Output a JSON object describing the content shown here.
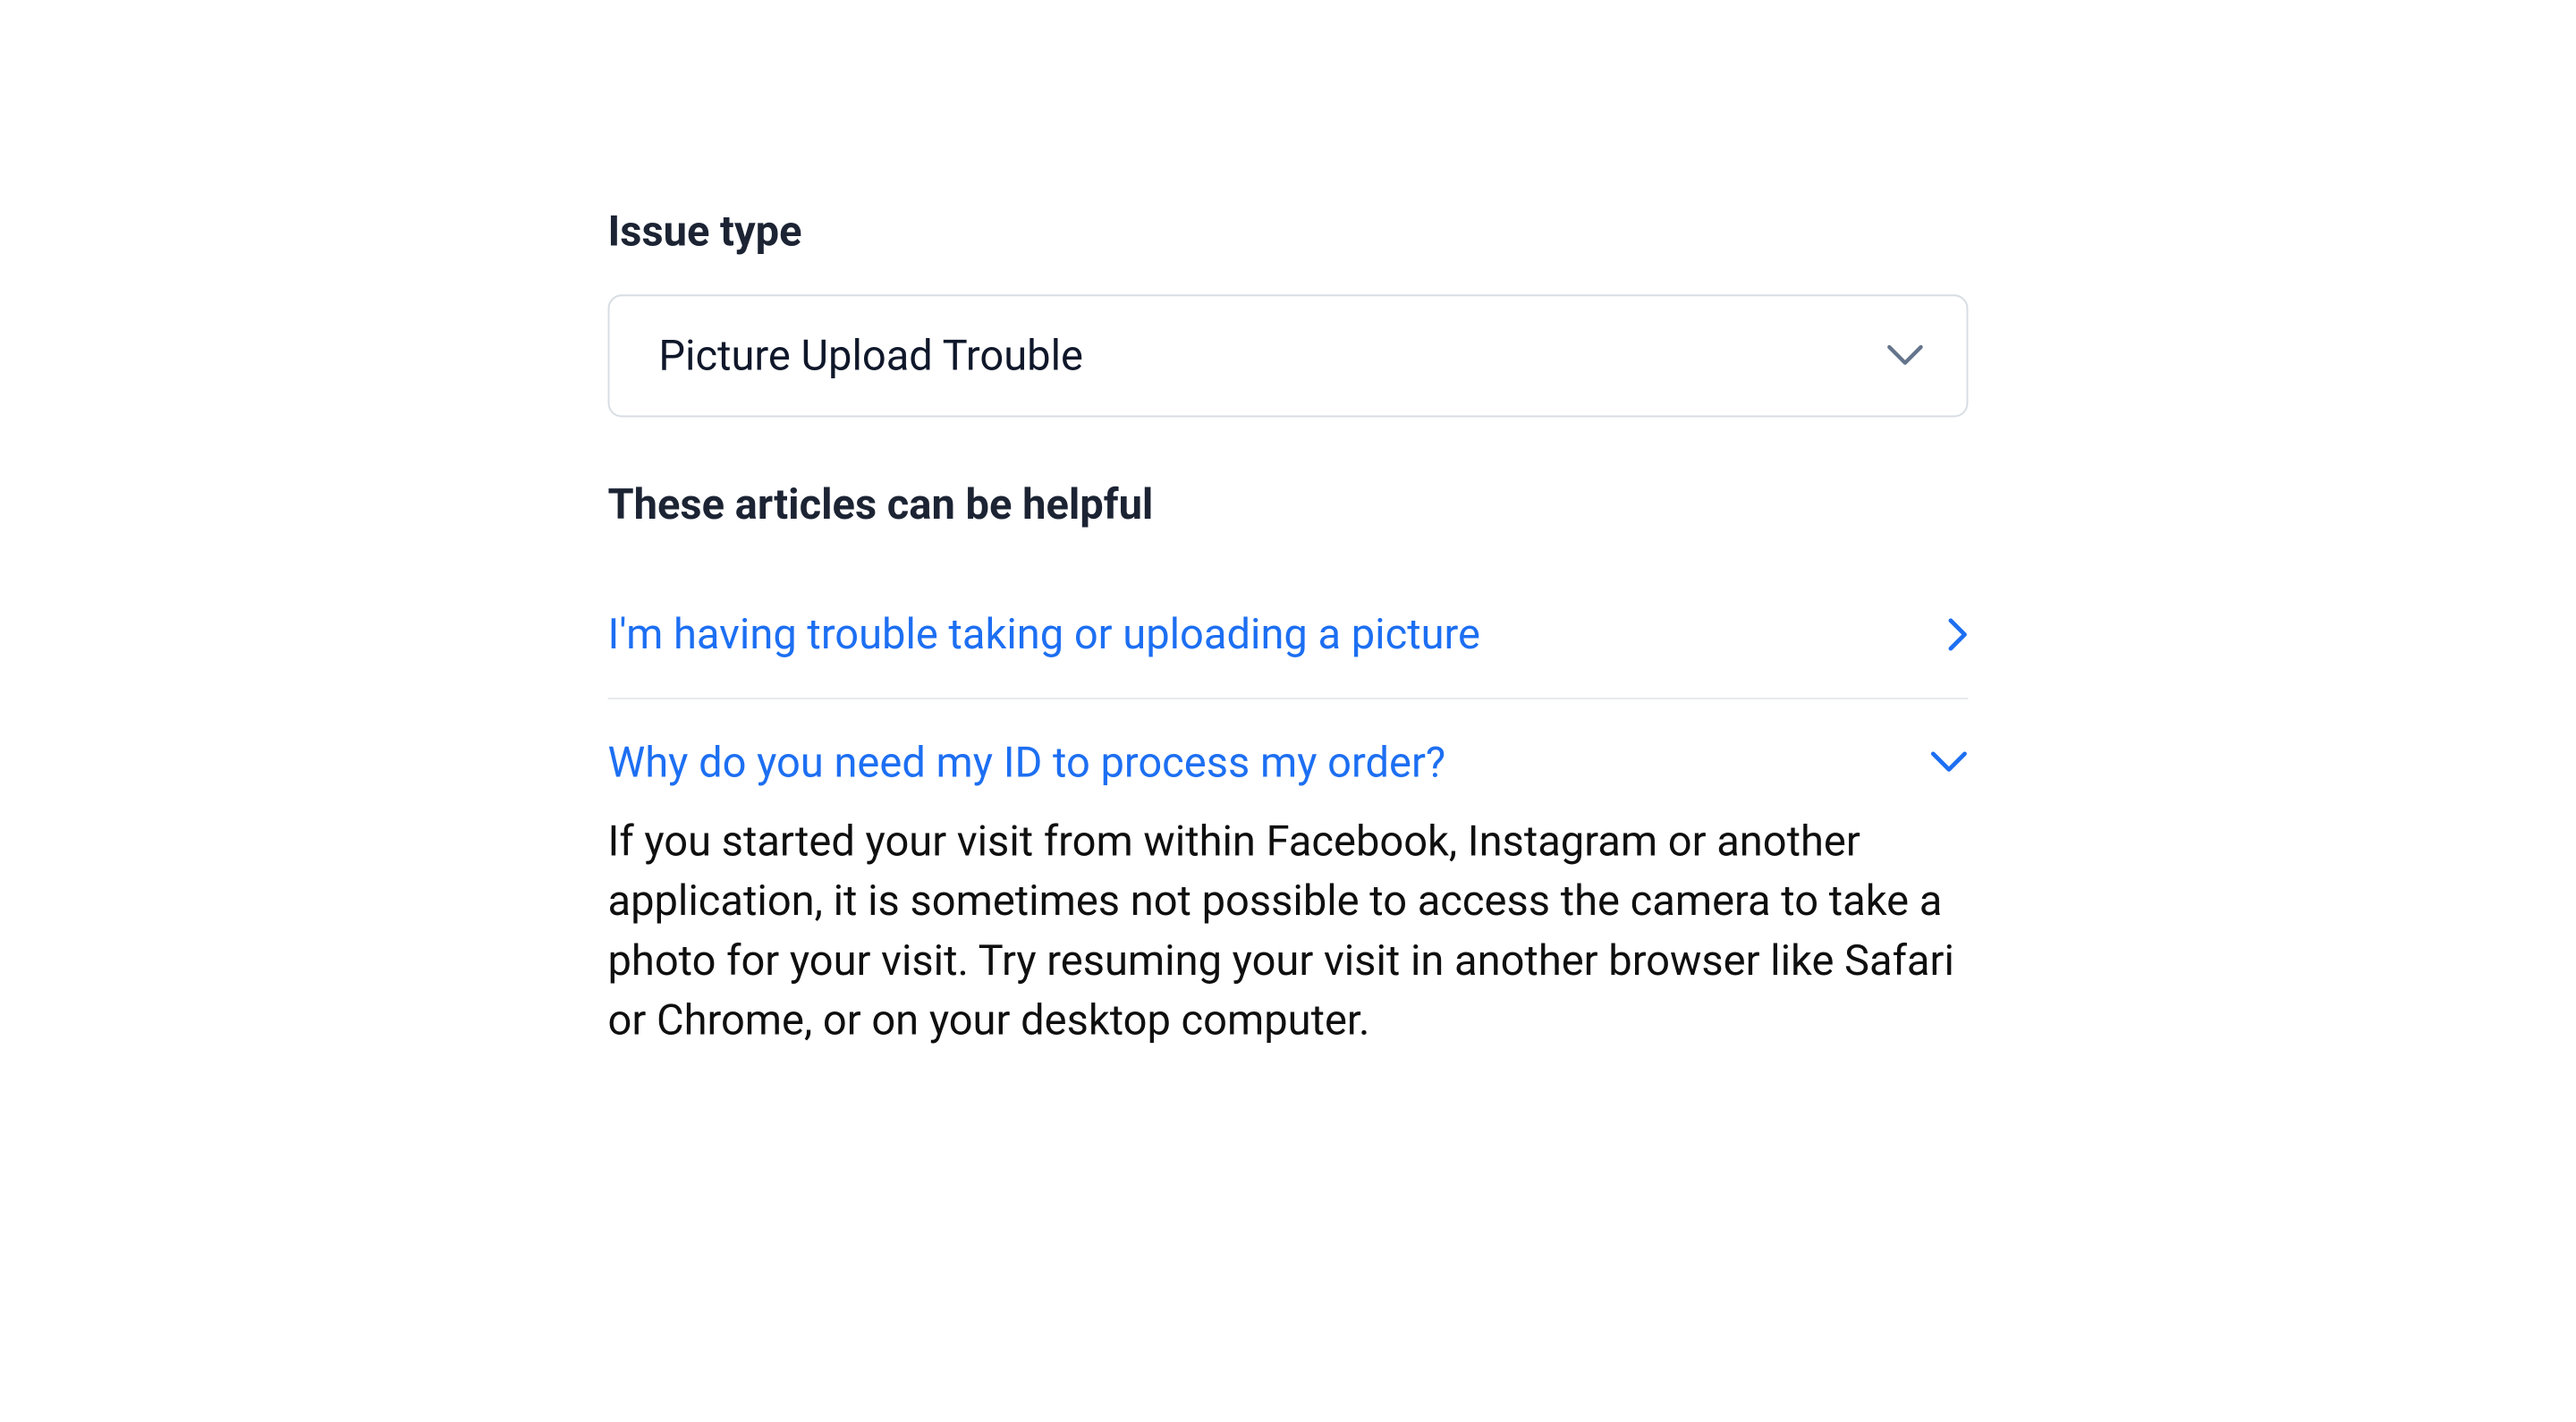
{
  "issueType": {
    "label": "Issue type",
    "selected": "Picture Upload Trouble"
  },
  "articles": {
    "heading": "These articles can be helpful",
    "items": [
      {
        "title": "I'm having trouble taking or uploading a picture",
        "expanded": false
      },
      {
        "title": "Why do you need my ID to process my order?",
        "expanded": true,
        "body": "If you started your visit from within Facebook, Instagram or another application, it is sometimes not possible to access the camera to take a photo for your visit. Try resuming your visit in another browser like Safari or Chrome, or on your desktop computer."
      }
    ]
  },
  "colors": {
    "link": "#1d6ff2",
    "heading": "#1c2434",
    "border": "#d7dde3",
    "chevronGray": "#64748b"
  }
}
